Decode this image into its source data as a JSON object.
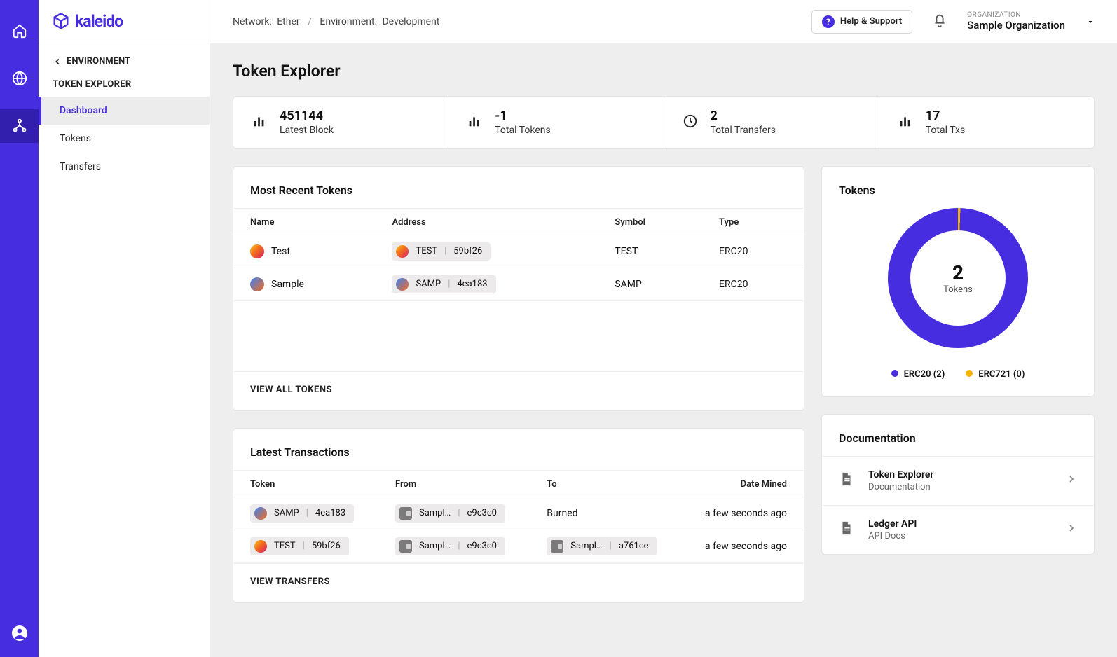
{
  "brand": "kaleido",
  "rail": [
    {
      "name": "home-icon"
    },
    {
      "name": "globe-icon"
    },
    {
      "name": "topology-icon",
      "active": true
    }
  ],
  "sidebar": {
    "back_label": "ENVIRONMENT",
    "section": "TOKEN EXPLORER",
    "items": [
      {
        "label": "Dashboard",
        "active": true
      },
      {
        "label": "Tokens"
      },
      {
        "label": "Transfers"
      }
    ]
  },
  "topbar": {
    "breadcrumb": {
      "network_key": "Network:",
      "network": "Ether",
      "env_key": "Environment:",
      "env": "Development"
    },
    "help": "Help & Support",
    "org_label": "ORGANIZATION",
    "org_name": "Sample Organization"
  },
  "page_title": "Token Explorer",
  "stats": [
    {
      "value": "451144",
      "label": "Latest Block",
      "icon": "bar-chart-icon"
    },
    {
      "value": "-1",
      "label": "Total Tokens",
      "icon": "bar-chart-icon"
    },
    {
      "value": "2",
      "label": "Total Transfers",
      "icon": "clock-icon"
    },
    {
      "value": "17",
      "label": "Total Txs",
      "icon": "bar-chart-icon"
    }
  ],
  "recent_tokens": {
    "title": "Most Recent Tokens",
    "columns": [
      "Name",
      "Address",
      "Symbol",
      "Type"
    ],
    "rows": [
      {
        "name": "Test",
        "dot": "a",
        "addr_sym": "TEST",
        "addr": "59bf26",
        "symbol": "TEST",
        "type": "ERC20"
      },
      {
        "name": "Sample",
        "dot": "b",
        "addr_sym": "SAMP",
        "addr": "4ea183",
        "symbol": "SAMP",
        "type": "ERC20"
      }
    ],
    "action": "VIEW ALL TOKENS"
  },
  "tokens_card": {
    "title": "Tokens",
    "value": "2",
    "label": "Tokens",
    "legend": [
      {
        "label": "ERC20 (2)",
        "color": "#462de0"
      },
      {
        "label": "ERC721 (0)",
        "color": "#f5b301"
      }
    ]
  },
  "chart_data": {
    "type": "pie",
    "title": "Tokens",
    "series": [
      {
        "name": "ERC20",
        "value": 2,
        "color": "#462de0"
      },
      {
        "name": "ERC721",
        "value": 0,
        "color": "#f5b301"
      }
    ],
    "total_label": "Tokens",
    "total_value": 2
  },
  "latest_tx": {
    "title": "Latest Transactions",
    "columns": [
      "Token",
      "From",
      "To",
      "Date Mined"
    ],
    "rows": [
      {
        "tok_dot": "b",
        "tok_sym": "SAMP",
        "tok_addr": "4ea183",
        "from_name": "Sampl…",
        "from_addr": "e9c3c0",
        "to_type": "text",
        "to": "Burned",
        "date": "a few seconds ago"
      },
      {
        "tok_dot": "a",
        "tok_sym": "TEST",
        "tok_addr": "59bf26",
        "from_name": "Sampl…",
        "from_addr": "e9c3c0",
        "to_type": "chip",
        "to_name": "Sampl…",
        "to_addr": "a761ce",
        "date": "a few seconds ago"
      }
    ],
    "action": "VIEW TRANSFERS"
  },
  "docs": {
    "title": "Documentation",
    "items": [
      {
        "title": "Token Explorer",
        "sub": "Documentation"
      },
      {
        "title": "Ledger API",
        "sub": "API Docs"
      }
    ]
  }
}
